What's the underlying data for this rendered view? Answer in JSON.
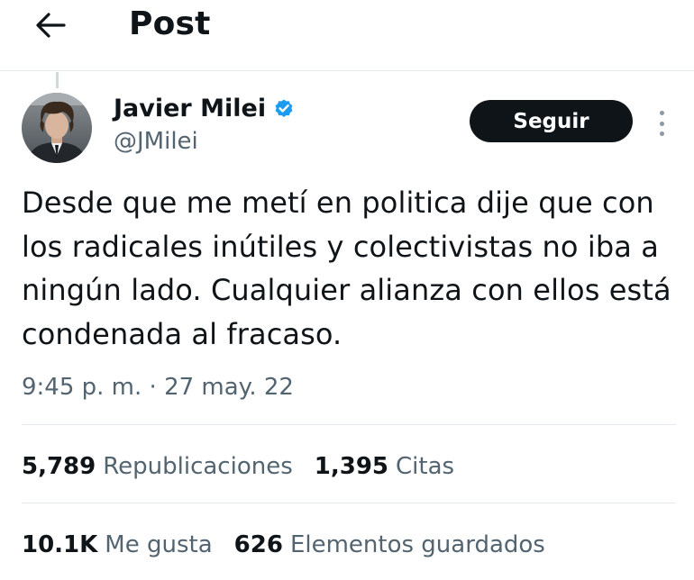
{
  "header": {
    "title": "Post",
    "back_icon": "arrow-left-icon"
  },
  "author": {
    "display_name": "Javier Milei",
    "handle": "@JMilei",
    "verified": true,
    "verified_color": "#1d9bf0",
    "follow_label": "Seguir"
  },
  "post": {
    "text": "Desde que me metí en politica dije que con los radicales inútiles y colectivistas no iba a ningún lado. Cualquier alianza con ellos está condenada al fracaso.",
    "timestamp": "9:45 p. m. · 27 may. 22"
  },
  "stats": {
    "reposts_value": "5,789",
    "reposts_label": "Republicaciones",
    "quotes_value": "1,395",
    "quotes_label": "Citas",
    "likes_value": "10.1K",
    "likes_label": "Me gusta",
    "bookmarks_value": "626",
    "bookmarks_label": "Elementos guardados"
  }
}
